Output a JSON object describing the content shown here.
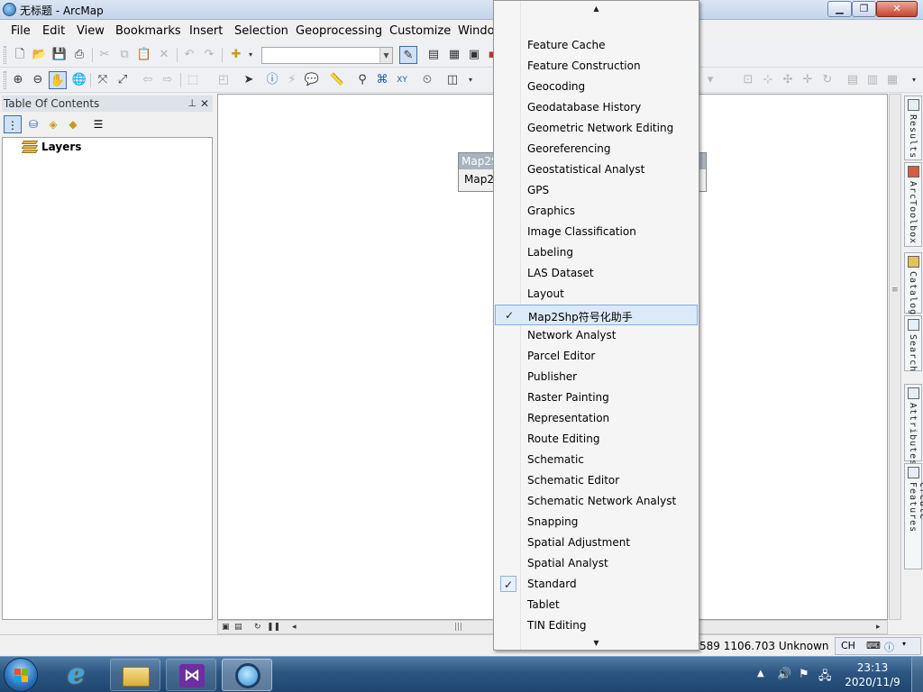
{
  "window": {
    "title": "无标题 - ArcMap",
    "minimize_glyph": "▁",
    "maximize_glyph": "❐",
    "close_glyph": "✕"
  },
  "menubar": {
    "items": [
      "File",
      "Edit",
      "View",
      "Bookmarks",
      "Insert",
      "Selection",
      "Geoprocessing",
      "Customize",
      "Windo"
    ]
  },
  "toc": {
    "title": "Table Of Contents",
    "pin_glyph": "⊥",
    "close_glyph": "✕",
    "root_label": "Layers"
  },
  "floating_toolbar": {
    "title": "Map2S",
    "button_label": "Map2"
  },
  "dropdown": {
    "items": [
      {
        "label": "Feature Cache",
        "checked": false
      },
      {
        "label": "Feature Construction",
        "checked": false
      },
      {
        "label": "Geocoding",
        "checked": false
      },
      {
        "label": "Geodatabase History",
        "checked": false
      },
      {
        "label": "Geometric Network Editing",
        "checked": false
      },
      {
        "label": "Georeferencing",
        "checked": false
      },
      {
        "label": "Geostatistical Analyst",
        "checked": false
      },
      {
        "label": "GPS",
        "checked": false
      },
      {
        "label": "Graphics",
        "checked": false
      },
      {
        "label": "Image Classification",
        "checked": false
      },
      {
        "label": "Labeling",
        "checked": false
      },
      {
        "label": "LAS Dataset",
        "checked": false
      },
      {
        "label": "Layout",
        "checked": false
      },
      {
        "label": "Map2Shp符号化助手",
        "checked": true,
        "highlighted": true
      },
      {
        "label": "Network Analyst",
        "checked": false
      },
      {
        "label": "Parcel Editor",
        "checked": false
      },
      {
        "label": "Publisher",
        "checked": false
      },
      {
        "label": "Raster Painting",
        "checked": false
      },
      {
        "label": "Representation",
        "checked": false
      },
      {
        "label": "Route Editing",
        "checked": false
      },
      {
        "label": "Schematic",
        "checked": false
      },
      {
        "label": "Schematic Editor",
        "checked": false
      },
      {
        "label": "Schematic Network Analyst",
        "checked": false
      },
      {
        "label": "Snapping",
        "checked": false
      },
      {
        "label": "Spatial Adjustment",
        "checked": false
      },
      {
        "label": "Spatial Analyst",
        "checked": false
      },
      {
        "label": "Standard",
        "checked": true
      },
      {
        "label": "Tablet",
        "checked": false
      },
      {
        "label": "TIN Editing",
        "checked": false
      }
    ],
    "check_glyph": "✓",
    "scroll_up_glyph": "▲",
    "scroll_down_glyph": "▼"
  },
  "right_dock": {
    "tabs": [
      "Results",
      "ArcToolbox",
      "Catalog",
      "Search",
      "Attributes",
      "Create Features"
    ]
  },
  "statusbar": {
    "coord_x_partial": "589",
    "coord_y": "1106.703",
    "units": "Unknown",
    "ime_lang": "CH"
  },
  "taskbar": {
    "time": "23:13",
    "date": "2020/11/9",
    "ie_glyph": "e",
    "vs_glyph": "⋈"
  }
}
